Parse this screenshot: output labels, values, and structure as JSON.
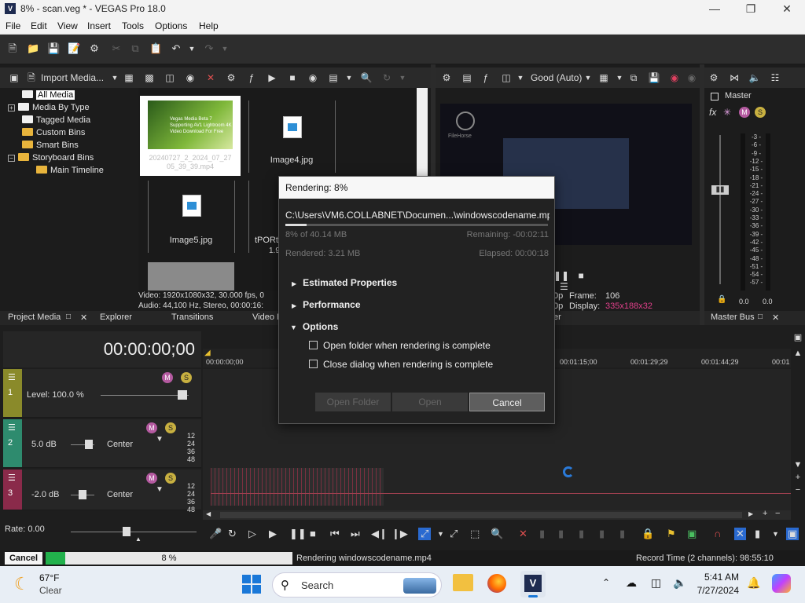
{
  "window": {
    "title": "8% - scan.veg * - VEGAS Pro 18.0",
    "app_icon": "V",
    "accent": "#1e2b50"
  },
  "menu": [
    "File",
    "Edit",
    "View",
    "Insert",
    "Tools",
    "Options",
    "Help"
  ],
  "project_media": {
    "import_label": "Import Media...",
    "tree": [
      "All Media",
      "Media By Type",
      "Tagged Media",
      "Custom Bins",
      "Smart Bins",
      "Storyboard Bins",
      "Main Timeline"
    ],
    "thumbs": [
      {
        "label": "20240727_2_2024_07_27 05_39_39.mp4",
        "overlay": "Vegas Media Beta 7 Supporting AV1 Lightroom 4K Video Download For Free"
      },
      {
        "label": "Image4.jpg"
      },
      {
        "label": "Image5.jpg"
      },
      {
        "label": "tPORt",
        "sub": "1.9"
      }
    ],
    "info_line1": "Video: 1920x1080x32, 30.000 fps, 0",
    "info_line2": "Audio: 44,100 Hz, Stereo, 00:00:16:"
  },
  "tabs_left": [
    "Project Media",
    "Explorer",
    "Transitions",
    "Video F"
  ],
  "preview": {
    "quality": "Good (Auto)",
    "frame_label": "Frame:",
    "frame_value": "106",
    "display_label": "Display:",
    "display_value": "335x188x32",
    "row_prefix1": "0p",
    "row_prefix2": "0p",
    "tab_partial": "er",
    "watermark_text": "FileHorse"
  },
  "master": {
    "title": "Master",
    "bus_tab": "Master Bus",
    "scale": [
      "3",
      "6",
      "9",
      "12",
      "15",
      "18",
      "21",
      "24",
      "27",
      "30",
      "33",
      "36",
      "39",
      "42",
      "45",
      "48",
      "51",
      "54",
      "57"
    ],
    "left_val": "0.0",
    "right_val": "0.0"
  },
  "dialog": {
    "title": "Rendering: 8%",
    "path": "C:\\Users\\VM6.COLLABNET\\Documen...\\windowscodename.mp4",
    "progress_pct": 8,
    "of_total": "8% of 40.14 MB",
    "remaining": "Remaining: -00:02:11",
    "rendered": "Rendered: 3.21 MB",
    "elapsed": "Elapsed: 00:00:18",
    "sections": [
      "Estimated Properties",
      "Performance",
      "Options"
    ],
    "options": [
      "Open folder when rendering is complete",
      "Close dialog when rendering is complete"
    ],
    "btn_open_folder": "Open Folder",
    "btn_open": "Open",
    "btn_cancel": "Cancel"
  },
  "timeline": {
    "timecode": "00:00:00;00",
    "ruler": [
      "00:00:00;00",
      "00:01:15;00",
      "00:01:29;29",
      "00:01:44;29",
      "00:01"
    ],
    "tracks": [
      {
        "num": "1",
        "label": "Level: 100.0 %",
        "color": "#8a8a2a"
      },
      {
        "num": "2",
        "db": "5.0 dB",
        "pan": "Center",
        "color": "#2e8b6e"
      },
      {
        "num": "3",
        "db": "-2.0 dB",
        "pan": "Center",
        "color": "#8a2a4a"
      }
    ],
    "meter_ticks": [
      "12",
      "24",
      "36",
      "48"
    ],
    "rate": "Rate: 0.00"
  },
  "status": {
    "cancel": "Cancel",
    "progress_pct": 8,
    "pct_text": "8 %",
    "message": "Rendering windowscodename.mp4",
    "record_time": "Record Time (2 channels): 98:55:10"
  },
  "taskbar": {
    "temp": "67°F",
    "weather": "Clear",
    "search": "Search",
    "time": "5:41 AM",
    "date": "7/27/2024"
  }
}
